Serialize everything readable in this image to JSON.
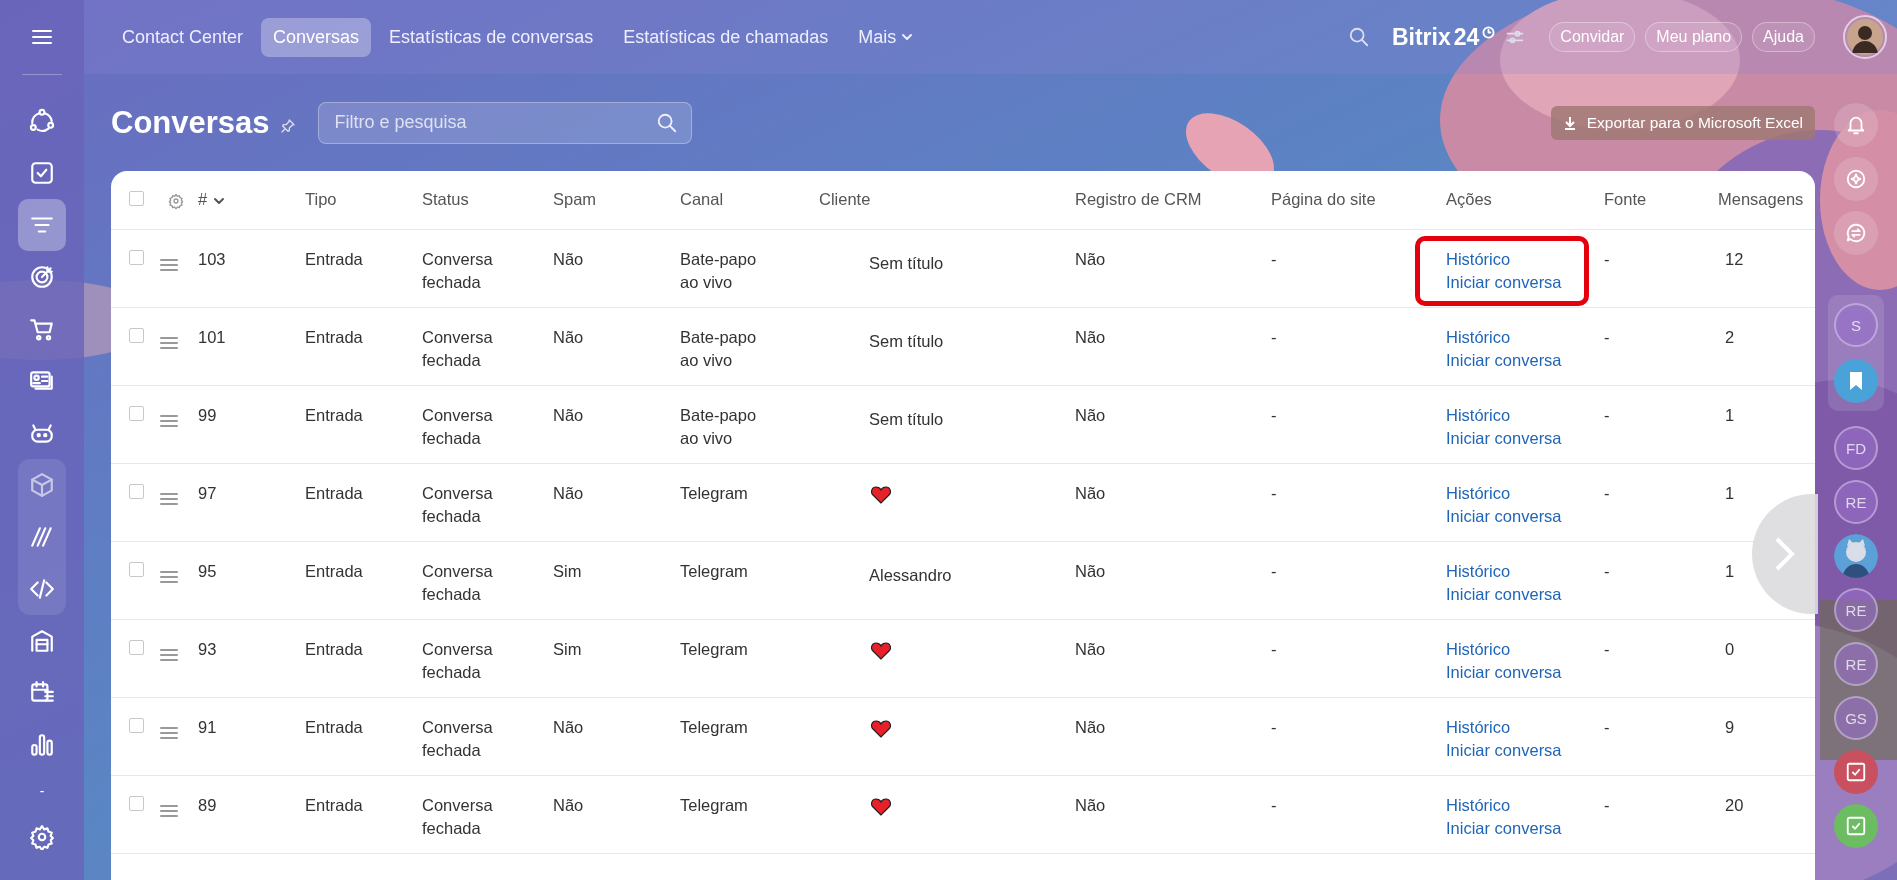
{
  "sidebar": {
    "items": [
      {
        "kind": "icon",
        "selected": false
      },
      {
        "kind": "icon",
        "selected": false
      },
      {
        "kind": "icon",
        "selected": true
      },
      {
        "kind": "icon",
        "selected": false
      },
      {
        "kind": "icon",
        "selected": false
      },
      {
        "kind": "icon",
        "selected": false
      },
      {
        "kind": "icon",
        "selected": false
      },
      {
        "kind": "group",
        "children": [
          {
            "kind": "icon",
            "selected": false
          },
          {
            "kind": "icon",
            "selected": false
          },
          {
            "kind": "icon",
            "selected": false
          }
        ]
      },
      {
        "kind": "icon",
        "selected": false
      },
      {
        "kind": "icon",
        "selected": false
      },
      {
        "kind": "icon",
        "selected": false
      },
      {
        "kind": "text",
        "label": "-"
      },
      {
        "kind": "icon",
        "selected": false
      }
    ]
  },
  "top_nav": {
    "tabs": [
      {
        "label": "Contact Center",
        "selected": false
      },
      {
        "label": "Conversas",
        "selected": true
      },
      {
        "label": "Estatísticas de conversas",
        "selected": false
      },
      {
        "label": "Estatísticas de chamadas",
        "selected": false
      },
      {
        "label": "Mais",
        "selected": false,
        "dropdown": true
      }
    ],
    "logo": {
      "name": "Bitrix",
      "number": "24"
    },
    "buttons": [
      "Convidar",
      "Meu plano",
      "Ajuda"
    ]
  },
  "header": {
    "title": "Conversas",
    "search": {
      "placeholder": "Filtro e pesquisa"
    },
    "export_button": "Exportar para o Microsoft Excel"
  },
  "table": {
    "header_checked": false,
    "columns": [
      "#",
      "Tipo",
      "Status",
      "Spam",
      "Canal",
      "Cliente",
      "Registro de CRM",
      "Página do site",
      "Ações",
      "Fonte",
      "Mensagens"
    ],
    "rows": [
      {
        "checked": false,
        "highlighted": true,
        "id": "103",
        "tipo": "Entrada",
        "status": "Conversa fechada",
        "spam": "Não",
        "canal": "Bate-papo ao vivo",
        "cliente": {
          "kind": "text",
          "text": "Sem título"
        },
        "crm": "Não",
        "pagina": "-",
        "acoes": [
          "Histórico",
          "Iniciar conversa"
        ],
        "fonte": "-",
        "mensagens": "12"
      },
      {
        "checked": false,
        "highlighted": false,
        "id": "101",
        "tipo": "Entrada",
        "status": "Conversa fechada",
        "spam": "Não",
        "canal": "Bate-papo ao vivo",
        "cliente": {
          "kind": "text",
          "text": "Sem título"
        },
        "crm": "Não",
        "pagina": "-",
        "acoes": [
          "Histórico",
          "Iniciar conversa"
        ],
        "fonte": "-",
        "mensagens": "2"
      },
      {
        "checked": false,
        "highlighted": false,
        "id": "99",
        "tipo": "Entrada",
        "status": "Conversa fechada",
        "spam": "Não",
        "canal": "Bate-papo ao vivo",
        "cliente": {
          "kind": "text",
          "text": "Sem título"
        },
        "crm": "Não",
        "pagina": "-",
        "acoes": [
          "Histórico",
          "Iniciar conversa"
        ],
        "fonte": "-",
        "mensagens": "1"
      },
      {
        "checked": false,
        "highlighted": false,
        "id": "97",
        "tipo": "Entrada",
        "status": "Conversa fechada",
        "spam": "Não",
        "canal": "Telegram",
        "cliente": {
          "kind": "heart"
        },
        "crm": "Não",
        "pagina": "-",
        "acoes": [
          "Histórico",
          "Iniciar conversa"
        ],
        "fonte": "-",
        "mensagens": "1"
      },
      {
        "checked": false,
        "highlighted": false,
        "id": "95",
        "tipo": "Entrada",
        "status": "Conversa fechada",
        "spam": "Sim",
        "canal": "Telegram",
        "cliente": {
          "kind": "text",
          "text": "Alessandro"
        },
        "crm": "Não",
        "pagina": "-",
        "acoes": [
          "Histórico",
          "Iniciar conversa"
        ],
        "fonte": "-",
        "mensagens": "1"
      },
      {
        "checked": false,
        "highlighted": false,
        "id": "93",
        "tipo": "Entrada",
        "status": "Conversa fechada",
        "spam": "Sim",
        "canal": "Telegram",
        "cliente": {
          "kind": "heart"
        },
        "crm": "Não",
        "pagina": "-",
        "acoes": [
          "Histórico",
          "Iniciar conversa"
        ],
        "fonte": "-",
        "mensagens": "0"
      },
      {
        "checked": false,
        "highlighted": false,
        "id": "91",
        "tipo": "Entrada",
        "status": "Conversa fechada",
        "spam": "Não",
        "canal": "Telegram",
        "cliente": {
          "kind": "heart"
        },
        "crm": "Não",
        "pagina": "-",
        "acoes": [
          "Histórico",
          "Iniciar conversa"
        ],
        "fonte": "-",
        "mensagens": "9"
      },
      {
        "checked": false,
        "highlighted": false,
        "id": "89",
        "tipo": "Entrada",
        "status": "Conversa fechada",
        "spam": "Não",
        "canal": "Telegram",
        "cliente": {
          "kind": "heart"
        },
        "crm": "Não",
        "pagina": "-",
        "acoes": [
          "Histórico",
          "Iniciar conversa"
        ],
        "fonte": "-",
        "mensagens": "20"
      }
    ]
  },
  "right_rail": {
    "items": [
      {
        "kind": "icon"
      },
      {
        "kind": "icon"
      },
      {
        "kind": "icon"
      },
      {
        "kind": "group",
        "children": [
          {
            "kind": "avatar",
            "initials": "S"
          },
          {
            "kind": "bookmark"
          }
        ]
      },
      {
        "kind": "avatar",
        "initials": "FD"
      },
      {
        "kind": "avatar",
        "initials": "RE"
      },
      {
        "kind": "picture"
      },
      {
        "kind": "avatar",
        "initials": "RE"
      },
      {
        "kind": "avatar",
        "initials": "RE"
      },
      {
        "kind": "avatar",
        "initials": "GS"
      },
      {
        "kind": "task",
        "color": "#c9505e"
      },
      {
        "kind": "task",
        "color": "#6cbd62"
      }
    ]
  }
}
